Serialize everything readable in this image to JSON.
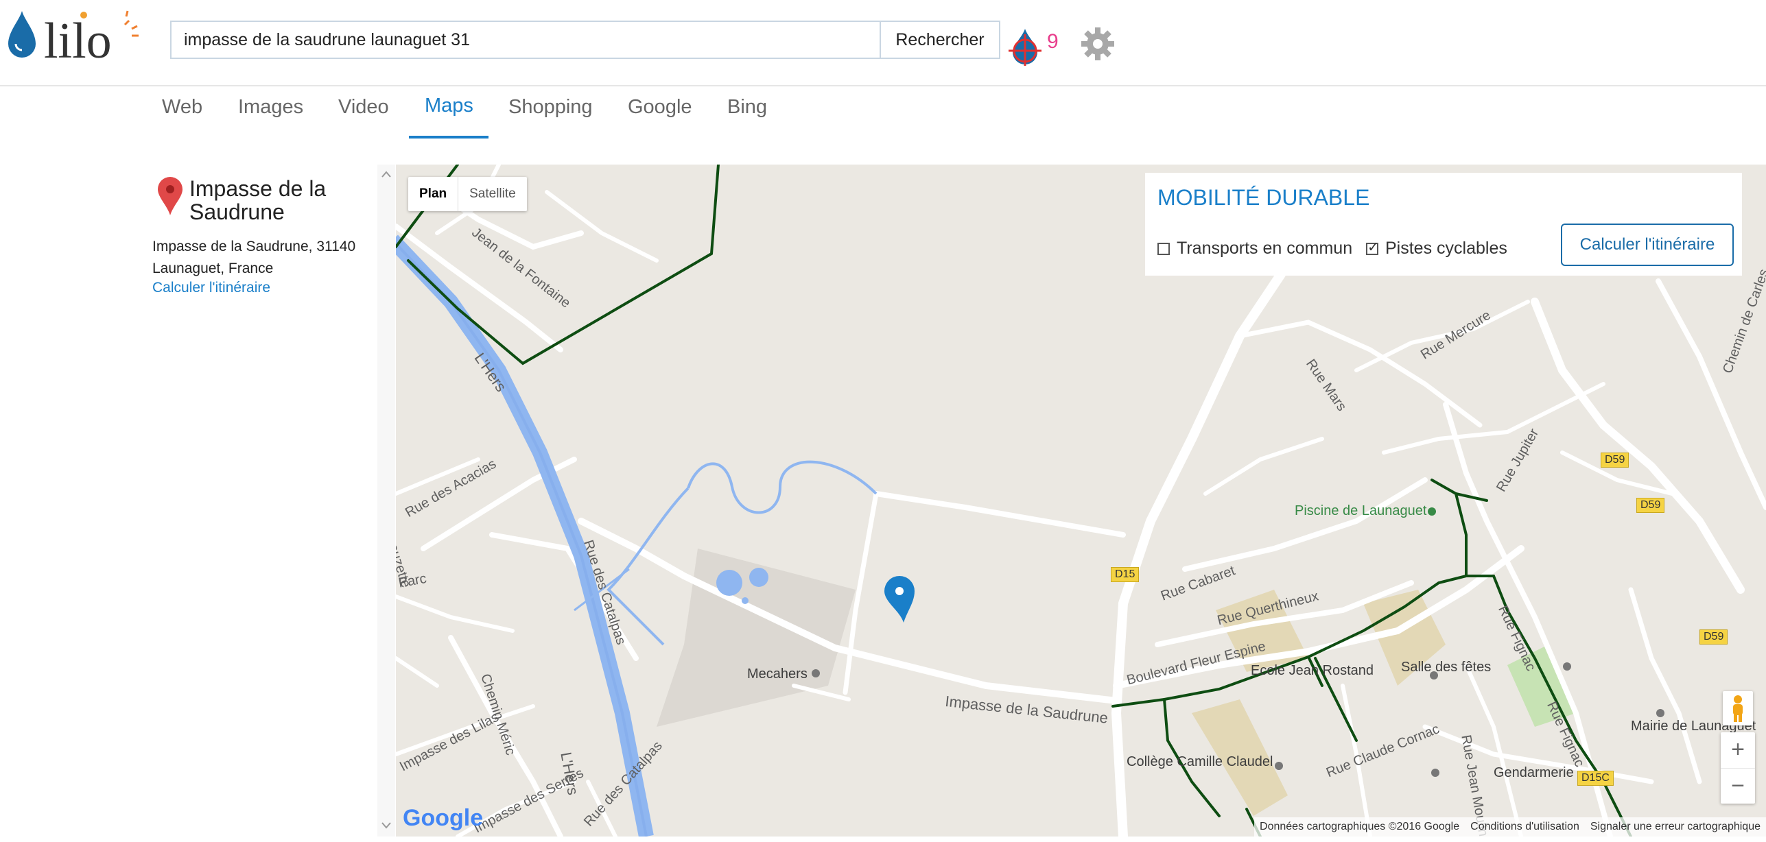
{
  "header": {
    "search_value": "impasse de la saudrune launaguet 31",
    "search_button": "Rechercher",
    "drop_count": "9"
  },
  "tabs": [
    {
      "label": "Web"
    },
    {
      "label": "Images"
    },
    {
      "label": "Video"
    },
    {
      "label": "Maps",
      "active": true
    },
    {
      "label": "Shopping"
    },
    {
      "label": "Google"
    },
    {
      "label": "Bing"
    }
  ],
  "result": {
    "title": "Impasse de la Saudrune",
    "address_line1": "Impasse de la Saudrune, 31140",
    "address_line2": "Launaguet, France",
    "route_link": "Calculer l'itinéraire"
  },
  "map": {
    "type_plan": "Plan",
    "type_satellite": "Satellite",
    "mobility": {
      "title": "MOBILITÉ DURABLE",
      "transports": "Transports en commun",
      "transports_checked": false,
      "cycling": "Pistes cyclables",
      "cycling_checked": true,
      "route_button": "Calculer l'itinéraire"
    },
    "labels": {
      "jean_fontaine": "Jean de la Fontaine",
      "hers1": "L'Hers",
      "hers2": "L'Hers",
      "acacias": "Rue des Acacias",
      "catalpas1": "Rue des Catalpas",
      "catalpas2": "Rue des Catalpas",
      "lilas": "Impasse des Lilas",
      "chemin_meric": "Chemin Méric",
      "serres": "Impasse des Serres",
      "mecahers": "Mecahers",
      "saudrune": "Impasse de la Saudrune",
      "rue_cabaret": "Rue Cabaret",
      "querthineux": "Rue Querthineux",
      "fleur_espine": "Boulevard Fleur Espine",
      "ecole": "Ecole Jean Rostand",
      "salle": "Salle des fêtes",
      "college": "Collège Camille Claudel",
      "claude_cornac": "Rue Claude Cornac",
      "gendarmerie": "Gendarmerie",
      "mairie": "Mairie de Launaguet",
      "piscine": "Piscine de Launaguet",
      "rue_mercure": "Rue Mercure",
      "rue_mars": "Rue Mars",
      "rue_jupiter": "Rue Jupiter",
      "fignac1": "Rue Fignac",
      "fignac2": "Rue Fignac",
      "jean_moulin": "Rue Jean Moulin",
      "chemin_carles": "Chemin de Carles",
      "parc": "Parc",
      "lauzette": "Lauzette"
    },
    "shields": {
      "d15": "D15",
      "d59a": "D59",
      "d59b": "D59",
      "d59c": "D59",
      "d15c": "D15C"
    },
    "zoom_in": "+",
    "zoom_out": "−",
    "google_logo": "Google",
    "attribution": {
      "data": "Données cartographiques ©2016 Google",
      "terms": "Conditions d'utilisation",
      "report": "Signaler une erreur cartographique"
    }
  },
  "colors": {
    "accent": "#1a7fc9",
    "drop_count": "#e83e8c",
    "river": "#8fb6f0",
    "bike_path": "#0e4d12"
  }
}
